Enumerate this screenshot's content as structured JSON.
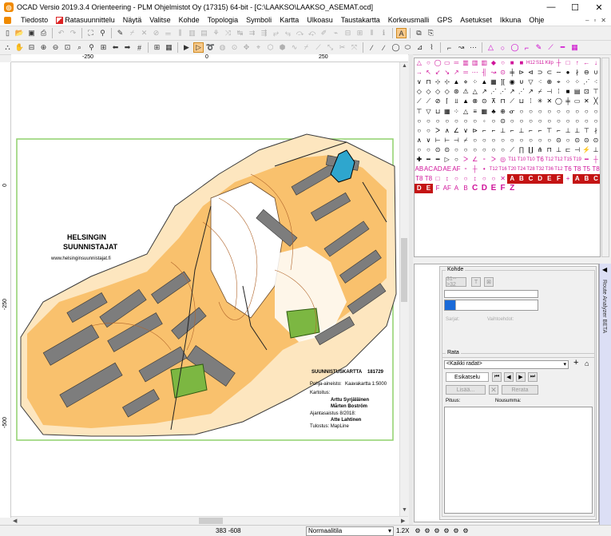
{
  "window": {
    "title": "OCAD Versio 2019.3.4  Orienteering - PLM Ohjelmistot Oy (17315) 64-bit - [C:\\LAAKSO\\LAAKSO_ASEMAT.ocd]",
    "minimize_icon": "minimize-icon",
    "maximize_icon": "maximize-icon",
    "close_icon": "close-icon"
  },
  "menu": {
    "items": [
      "Tiedosto",
      "Ratasuunnittelu",
      "Näytä",
      "Valitse",
      "Kohde",
      "Topologia",
      "Symboli",
      "Kartta",
      "Ulkoasu",
      "Taustakartta",
      "Korkeusmalli",
      "GPS",
      "Asetukset",
      "Ikkuna",
      "Ohje"
    ]
  },
  "ruler": {
    "h_ticks": [
      "-250",
      "0",
      "250"
    ],
    "v_ticks": [
      "0",
      "-250",
      "-500"
    ]
  },
  "map": {
    "club_line1": "HELSINGIN",
    "club_line2": "SUUNNISTAJAT",
    "club_url": "www.helsinginsuunnistajat.fi",
    "info_title": "SUUNNISTUSKARTTA",
    "info_number": "181729",
    "base_label": "Pohja-aineisto:",
    "base_value": "Kaavakartta 1:5000",
    "mapping_label": "Kartoitus:",
    "mapper1": "Arttu Syrjäläinen",
    "mapper2": "Mårten Boström",
    "updated_label": "Ajantasaistus 8/2018:",
    "updater": "Atte Lahtinen",
    "print_label": "Tulostus: MapLine"
  },
  "symbol_rows": [
    "△ ○ ◯ ▭ ═ ▥ ▥ ▥ ◆ ○ ■ ■ H12 S11",
    "Kilp ┼ □ ↑ ← ↓ → ↖ ↙ ↘ ↗ ═ ⋯ ╢ ↝ ⊙",
    "╪ ⊳ ⊲ ⊃ ⊂ ∼ ● ∤ ⊖ ∪ ∨ ⊓ ⊹ ⊹ ▲ ⋄",
    "⁘ ▲ ▦ ][ ◉ ⊍ ▽ ⁖ ⊕ ⌖ ⁘ ⁘ ⋰ ⁖ ◇ ◇",
    "◇ ◇ ⊛ ⚠ △ ↗ ⋰ ⋰ ↗ ⋰ ↗ ⌿ ⊣ ⁞ ■ ▤",
    "⊡ ⊤ ⟋ ⟋ ⊘ ⌈ ⫫ ▲ ⊗ ⊙ ⊼ ⊓ ⟋ ⊔ ⁞ ✳",
    "✕ ◯ ╪ ▭ ✕ ╳ ⊤ ▽ ⊔ ▦ ⁘ △ ≡ ▦ ♣ ⊕",
    "ᓂ ○ ○ ○ ○ ○ ○ ○ ○ ○ ○ ○ ○ ○ ○ ○",
    "○ ◦ ○ ⊙ ○ ○ ○ ○ ○ ○ ○ ○ ○ ○ ○ ○",
    "ᐳ ∧ ∠ ∨ ⊳ ⌐ ⌐ ⊥ ⌐ ⊥ ⌐ ⌐ ⊤ ⌐ ⊥ ⊥",
    "⊤ ∤ ∧ ∨ ⊢ ⊢ ⊣ ⌿ ○ ○ ○ ○ ○ ○ ○ ○",
    "○ ⊙ ○ ⊙ ⊙ ⊙ ○ ○ ⊙ ⊙ ○ ○ ○ ○ ○ ○",
    "⟋ ∏ ∐ ⋔ ⊓ ⊥ ⊏ ⊣ ⚡ ⊥ ✚ ━ ━ ▷ ○ ",
    "ᐳ ∠ ⁃ ᐳ ◎ T11 T10 T10 T6 T12 T12 T15 T19 ━ ┼ ",
    "AB AC AD AE AF ⁃ ┼ • T12 T16 T20 T24 T28 T32 T36 T12",
    "T6 T8 T5 T8 T8 T8 □ ↕ ○ ○ ↕ ○ ○ ✕ ",
    "A B C D E F + A B C D E F AF A B",
    "C D E F Z"
  ],
  "kohde": {
    "label": "Kohde",
    "btn1": "31-->32",
    "btn2": "T",
    "btn3": "⊠",
    "lbl_sarja": "Sarjat:",
    "lbl_vaihtoehdot": "Vaihtoehdot:"
  },
  "rata": {
    "label": "Rata",
    "select_value": "<Kaikki radat>",
    "add_icon": "plus-icon",
    "new_icon": "new-course-icon",
    "preview_btn": "Esikatselu",
    "add_btn": "Lisää...",
    "refresh_btn": "Rerata",
    "pituus_label": "Pituus:",
    "nousu_label": "Nousumma:"
  },
  "side_panel_label": "Route Analyzer BETA",
  "status": {
    "coords": "383  -608",
    "mode": "Normaalitila",
    "zoom": "1.2X"
  }
}
